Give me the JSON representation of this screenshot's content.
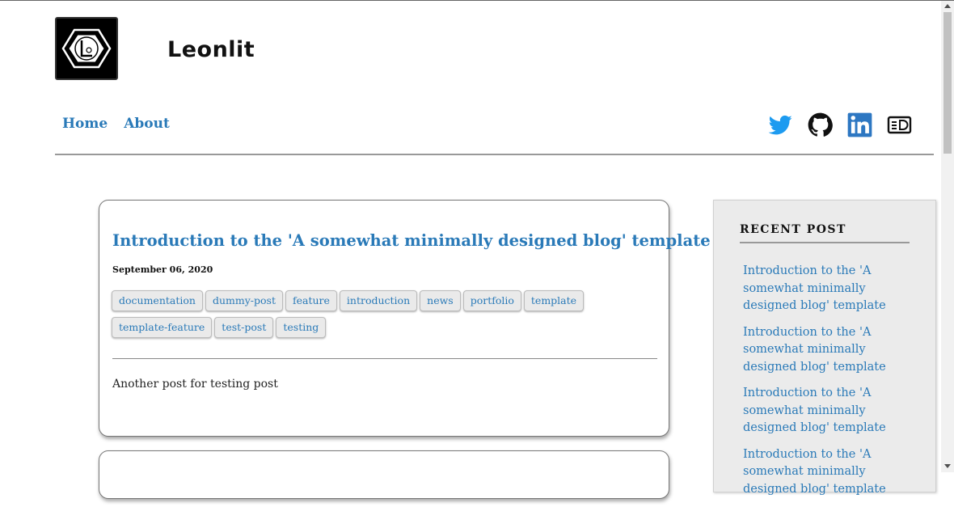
{
  "site": {
    "title": "Leonlit",
    "logo_icon": "hexagon-L-logo-icon"
  },
  "nav": {
    "items": [
      {
        "label": "Home"
      },
      {
        "label": "About"
      }
    ]
  },
  "social": {
    "icons": [
      "twitter-icon",
      "github-icon",
      "linkedin-icon",
      "blog-icon"
    ],
    "colors": {
      "twitter": "#1d9bf0",
      "linkedin": "#2d77c2"
    }
  },
  "post": {
    "title": "Introduction to the 'A somewhat minimally designed blog' template",
    "date": "September 06, 2020",
    "tags": [
      "documentation",
      "dummy-post",
      "feature",
      "introduction",
      "news",
      "portfolio",
      "template",
      "template-feature",
      "test-post",
      "testing"
    ],
    "excerpt": "Another post for testing post"
  },
  "sidebar": {
    "heading": "RECENT POST",
    "links": [
      "Introduction to the 'A somewhat minimally designed blog' template",
      "Introduction to the 'A somewhat minimally designed blog' template",
      "Introduction to the 'A somewhat minimally designed blog' template",
      "Introduction to the 'A somewhat minimally designed blog' template"
    ]
  },
  "theme": {
    "link_color": "#2a7ab8",
    "sidebar_bg": "#ebebeb"
  }
}
